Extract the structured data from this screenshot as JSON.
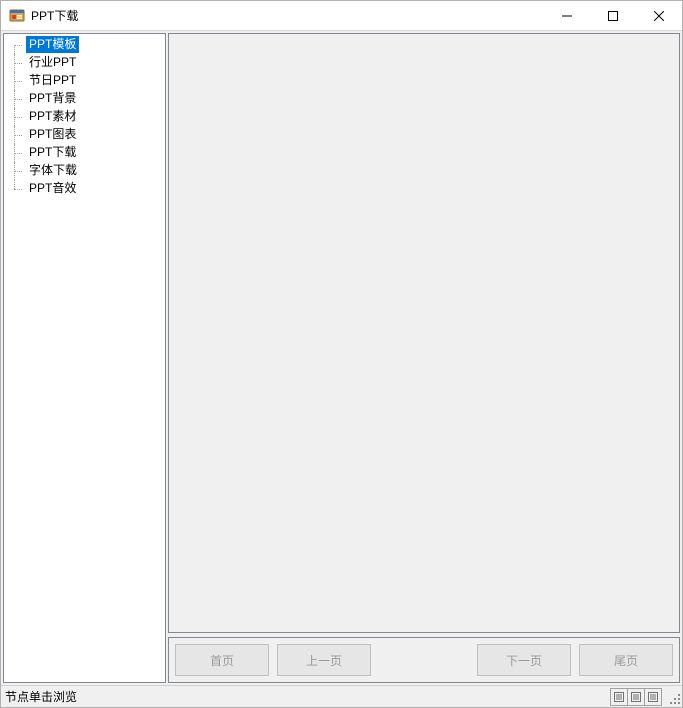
{
  "window": {
    "title": "PPT下载"
  },
  "tree": {
    "selected_index": 0,
    "items": [
      "PPT模板",
      "行业PPT",
      "节日PPT",
      "PPT背景",
      "PPT素材",
      "PPT图表",
      "PPT下载",
      "字体下载",
      "PPT音效"
    ]
  },
  "pager": {
    "first": "首页",
    "prev": "上一页",
    "next": "下一页",
    "last": "尾页"
  },
  "status": {
    "text": "节点单击浏览"
  },
  "colors": {
    "selection": "#0078d7",
    "panel_border": "#828790",
    "chrome_bg": "#f0f0f0"
  }
}
